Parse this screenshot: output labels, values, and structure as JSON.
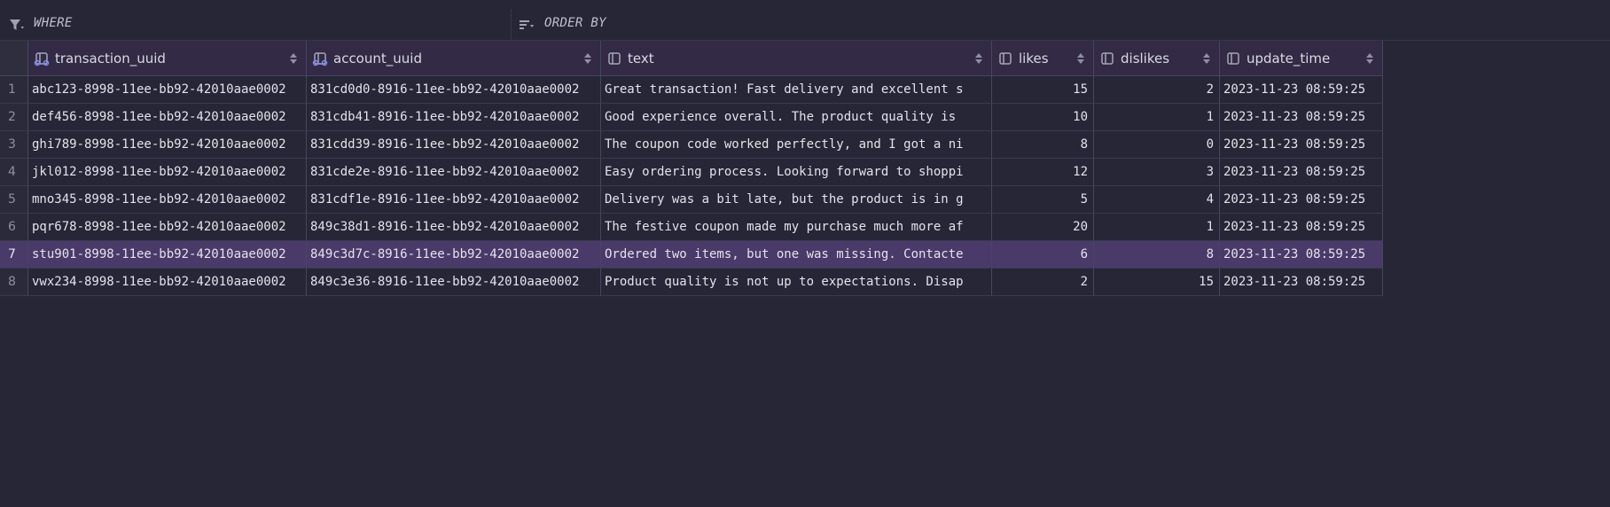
{
  "filters": {
    "where_label": "WHERE",
    "orderby_label": "ORDER BY"
  },
  "table": {
    "columns": [
      {
        "name": "transaction_uuid",
        "icon": "key-column-icon"
      },
      {
        "name": "account_uuid",
        "icon": "key-column-icon"
      },
      {
        "name": "text",
        "icon": "column-icon"
      },
      {
        "name": "likes",
        "icon": "column-icon"
      },
      {
        "name": "dislikes",
        "icon": "column-icon"
      },
      {
        "name": "update_time",
        "icon": "column-icon"
      }
    ],
    "rows": [
      {
        "n": "1",
        "transaction_uuid": "abc123-8998-11ee-bb92-42010aae0002",
        "account_uuid": "831cd0d0-8916-11ee-bb92-42010aae0002",
        "text": "Great transaction! Fast delivery and excellent s",
        "likes": "15",
        "dislikes": "2",
        "update_time": "2023-11-23 08:59:25"
      },
      {
        "n": "2",
        "transaction_uuid": "def456-8998-11ee-bb92-42010aae0002",
        "account_uuid": "831cdb41-8916-11ee-bb92-42010aae0002",
        "text": "Good experience overall. The product quality is ",
        "likes": "10",
        "dislikes": "1",
        "update_time": "2023-11-23 08:59:25"
      },
      {
        "n": "3",
        "transaction_uuid": "ghi789-8998-11ee-bb92-42010aae0002",
        "account_uuid": "831cdd39-8916-11ee-bb92-42010aae0002",
        "text": "The coupon code worked perfectly, and I got a ni",
        "likes": "8",
        "dislikes": "0",
        "update_time": "2023-11-23 08:59:25"
      },
      {
        "n": "4",
        "transaction_uuid": "jkl012-8998-11ee-bb92-42010aae0002",
        "account_uuid": "831cde2e-8916-11ee-bb92-42010aae0002",
        "text": "Easy ordering process. Looking forward to shoppi",
        "likes": "12",
        "dislikes": "3",
        "update_time": "2023-11-23 08:59:25"
      },
      {
        "n": "5",
        "transaction_uuid": "mno345-8998-11ee-bb92-42010aae0002",
        "account_uuid": "831cdf1e-8916-11ee-bb92-42010aae0002",
        "text": "Delivery was a bit late, but the product is in g",
        "likes": "5",
        "dislikes": "4",
        "update_time": "2023-11-23 08:59:25"
      },
      {
        "n": "6",
        "transaction_uuid": "pqr678-8998-11ee-bb92-42010aae0002",
        "account_uuid": "849c38d1-8916-11ee-bb92-42010aae0002",
        "text": "The festive coupon made my purchase much more af",
        "likes": "20",
        "dislikes": "1",
        "update_time": "2023-11-23 08:59:25"
      },
      {
        "n": "7",
        "transaction_uuid": "stu901-8998-11ee-bb92-42010aae0002",
        "account_uuid": "849c3d7c-8916-11ee-bb92-42010aae0002",
        "text": "Ordered two items, but one was missing. Contacte",
        "likes": "6",
        "dislikes": "8",
        "update_time": "2023-11-23 08:59:25",
        "selected": true
      },
      {
        "n": "8",
        "transaction_uuid": "vwx234-8998-11ee-bb92-42010aae0002",
        "account_uuid": "849c3e36-8916-11ee-bb92-42010aae0002",
        "text": "Product quality is not up to expectations. Disap",
        "likes": "2",
        "dislikes": "15",
        "update_time": "2023-11-23 08:59:25"
      }
    ]
  },
  "colors": {
    "background": "#262637",
    "header": "#332a45",
    "selected_row": "#4a3a6a",
    "icon_accent": "#7b8cff"
  }
}
